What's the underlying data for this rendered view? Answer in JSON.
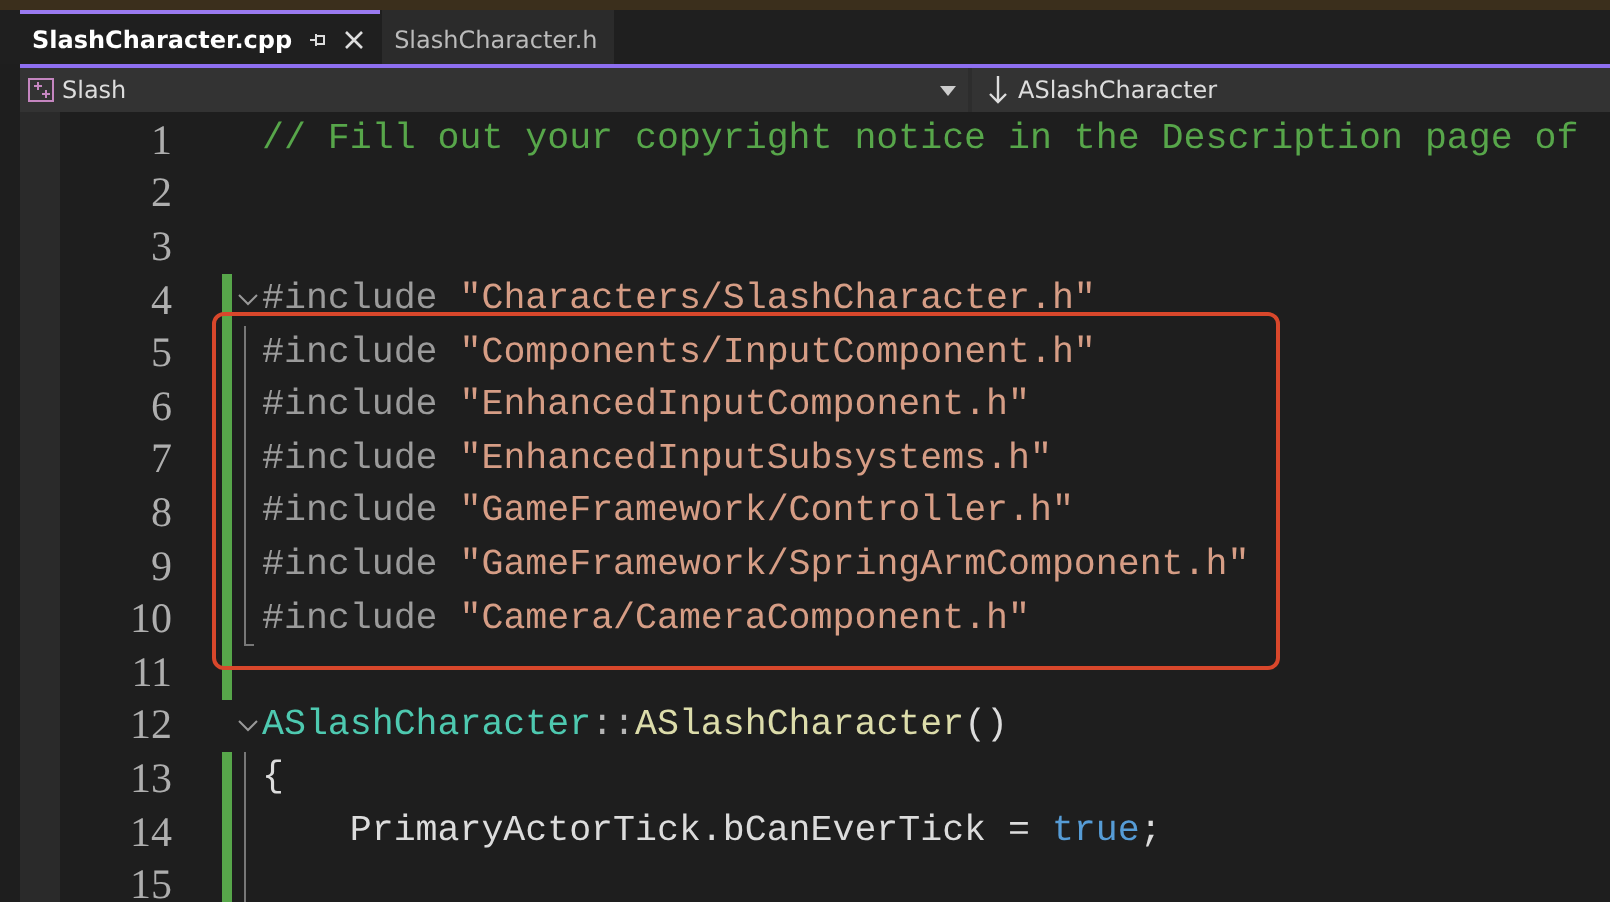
{
  "tabs": [
    {
      "label": "SlashCharacter.cpp",
      "selected": true,
      "pinnable": true,
      "closable": true
    },
    {
      "label": "SlashCharacter.h",
      "selected": false,
      "pinnable": false,
      "closable": false
    }
  ],
  "navigation": {
    "project": "Slash",
    "member": "ASlashCharacter"
  },
  "lines": [
    {
      "number": "1",
      "changed": false,
      "kind": "plain",
      "tokens": [
        {
          "kind": "comment",
          "text": "// Fill out your copyright notice in the Description page of "
        }
      ]
    },
    {
      "number": "2",
      "changed": false,
      "kind": "plain"
    },
    {
      "number": "3",
      "changed": false,
      "kind": "plain"
    },
    {
      "number": "4",
      "changed": true,
      "kind": "fold",
      "tokens": [
        {
          "kind": "directive",
          "text": "#include "
        },
        {
          "kind": "string",
          "text": "\"Characters/SlashCharacter.h\""
        }
      ]
    },
    {
      "number": "5",
      "changed": true,
      "kind": "guide",
      "tokens": [
        {
          "kind": "directive",
          "text": "#include "
        },
        {
          "kind": "string",
          "text": "\"Components/InputComponent.h\""
        }
      ]
    },
    {
      "number": "6",
      "changed": true,
      "kind": "guide",
      "tokens": [
        {
          "kind": "directive",
          "text": "#include "
        },
        {
          "kind": "string",
          "text": "\"EnhancedInputComponent.h\""
        }
      ]
    },
    {
      "number": "7",
      "changed": true,
      "kind": "guide",
      "tokens": [
        {
          "kind": "directive",
          "text": "#include "
        },
        {
          "kind": "string",
          "text": "\"EnhancedInputSubsystems.h\""
        }
      ]
    },
    {
      "number": "8",
      "changed": true,
      "kind": "guide",
      "tokens": [
        {
          "kind": "directive",
          "text": "#include "
        },
        {
          "kind": "string",
          "text": "\"GameFramework/Controller.h\""
        }
      ]
    },
    {
      "number": "9",
      "changed": true,
      "kind": "guide",
      "tokens": [
        {
          "kind": "directive",
          "text": "#include "
        },
        {
          "kind": "string",
          "text": "\"GameFramework/SpringArmComponent.h\""
        }
      ]
    },
    {
      "number": "10",
      "changed": true,
      "kind": "guideend",
      "tokens": [
        {
          "kind": "directive",
          "text": "#include "
        },
        {
          "kind": "string",
          "text": "\"Camera/CameraComponent.h\""
        }
      ]
    },
    {
      "number": "11",
      "changed": true,
      "kind": "plain"
    },
    {
      "number": "12",
      "changed": false,
      "kind": "fold",
      "tokens": [
        {
          "kind": "type",
          "text": "ASlashCharacter"
        },
        {
          "kind": "punct",
          "text": "::"
        },
        {
          "kind": "function",
          "text": "ASlashCharacter"
        },
        {
          "kind": "plain",
          "text": "()"
        }
      ]
    },
    {
      "number": "13",
      "changed": true,
      "kind": "guide",
      "tokens": [
        {
          "kind": "plain",
          "text": "{"
        }
      ]
    },
    {
      "number": "14",
      "changed": true,
      "kind": "guide",
      "tokens": [
        {
          "kind": "plain",
          "text": "    PrimaryActorTick.bCanEverTick = "
        },
        {
          "kind": "keyword",
          "text": "true"
        },
        {
          "kind": "plain",
          "text": ";"
        }
      ]
    },
    {
      "number": "15",
      "changed": true,
      "kind": "guide"
    }
  ],
  "annotation": {
    "kind": "box"
  }
}
